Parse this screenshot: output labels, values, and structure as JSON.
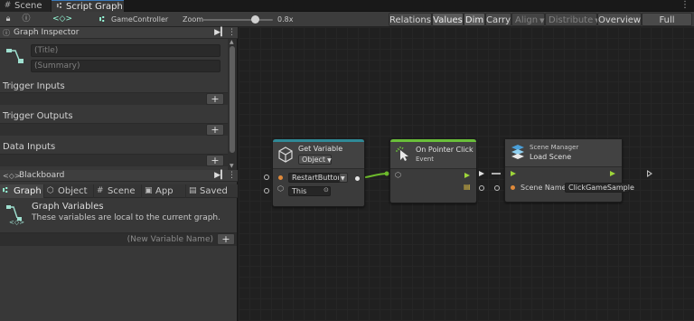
{
  "tabs": [
    {
      "label": "Scene",
      "icon": "hash-icon"
    },
    {
      "label": "Script Graph",
      "icon": "graph-icon"
    }
  ],
  "toolbar": {
    "breadcrumb": "GameController",
    "zoom_label": "Zoom",
    "zoom_value": "0.8x",
    "zoom_fraction": 0.75,
    "buttons": [
      "Relations",
      "Values",
      "Dim",
      "Carry",
      "Align",
      "Distribute",
      "Overview",
      "Full Screen"
    ]
  },
  "inspector": {
    "header": "Graph Inspector",
    "title_placeholder": "(Title)",
    "summary_placeholder": "(Summary)",
    "sections": [
      "Trigger Inputs",
      "Trigger Outputs",
      "Data Inputs"
    ],
    "add_label": "+"
  },
  "blackboard": {
    "header": "Blackboard",
    "tabs": [
      "Graph",
      "Object",
      "Scene",
      "App",
      "Saved"
    ],
    "graph_variables_title": "Graph Variables",
    "graph_variables_desc": "These variables are local to the current graph.",
    "new_variable_placeholder": "(New Variable Name)",
    "add_label": "+"
  },
  "nodes": {
    "get_variable": {
      "title": "Get Variable",
      "kind": "Object",
      "name_value": "RestartButton",
      "target": "This",
      "accent": "#2f8a97"
    },
    "pointer_click": {
      "title": "On Pointer Click",
      "subtitle": "Event",
      "accent": "#6abf3a"
    },
    "load_scene": {
      "category": "Scene Manager",
      "title": "Load Scene",
      "param_label": "Scene Name",
      "param_value": "ClickGameSample"
    }
  },
  "colors": {
    "flow": "#9ed53a",
    "value_port": "#e08a3a",
    "selection": "#3a79bb"
  }
}
